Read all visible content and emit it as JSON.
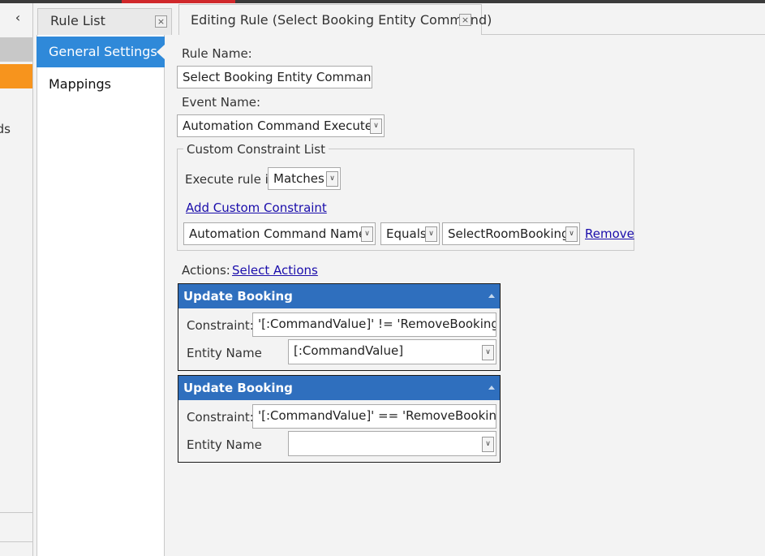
{
  "left_panel": {
    "collapse_glyph": "‹",
    "partial_text": "ds"
  },
  "rule_list_tab": {
    "label": "Rule List",
    "close_glyph": "×"
  },
  "nav": {
    "items": [
      {
        "label": "General Settings"
      },
      {
        "label": "Mappings"
      }
    ]
  },
  "editing_tab": {
    "label": "Editing Rule (Select Booking Entity Command)",
    "close_glyph": "×"
  },
  "form": {
    "rule_name_label": "Rule Name:",
    "rule_name_value": "Select Booking Entity Command",
    "event_name_label": "Event Name:",
    "event_name_value": "Automation Command Executed",
    "constraint_list_title": "Custom Constraint List",
    "execute_rule_label": "Execute rule if",
    "execute_rule_value": "Matches",
    "add_constraint_link": "Add Custom Constraint",
    "constraint_row": {
      "field": "Automation Command Name",
      "operator": "Equals",
      "value": "SelectRoomBooking",
      "remove_link": "Remove"
    },
    "actions_label": "Actions:",
    "select_actions_link": "Select Actions"
  },
  "actions": [
    {
      "title": "Update Booking",
      "constraint_label": "Constraint:",
      "constraint_value": "'[:CommandValue]' != 'RemoveBooking'",
      "entity_label": "Entity Name",
      "entity_value": "[:CommandValue]"
    },
    {
      "title": "Update Booking",
      "constraint_label": "Constraint:",
      "constraint_value": "'[:CommandValue]' == 'RemoveBooking'",
      "entity_label": "Entity Name",
      "entity_value": ""
    }
  ],
  "icons": {
    "dropdown": "chevron-down-icon",
    "collapse_section": "triangle-up-icon"
  },
  "colors": {
    "accent_blue": "#2f89d9",
    "action_header": "#2f6fbe",
    "orange": "#f7941d",
    "top_red": "#d0282b"
  }
}
